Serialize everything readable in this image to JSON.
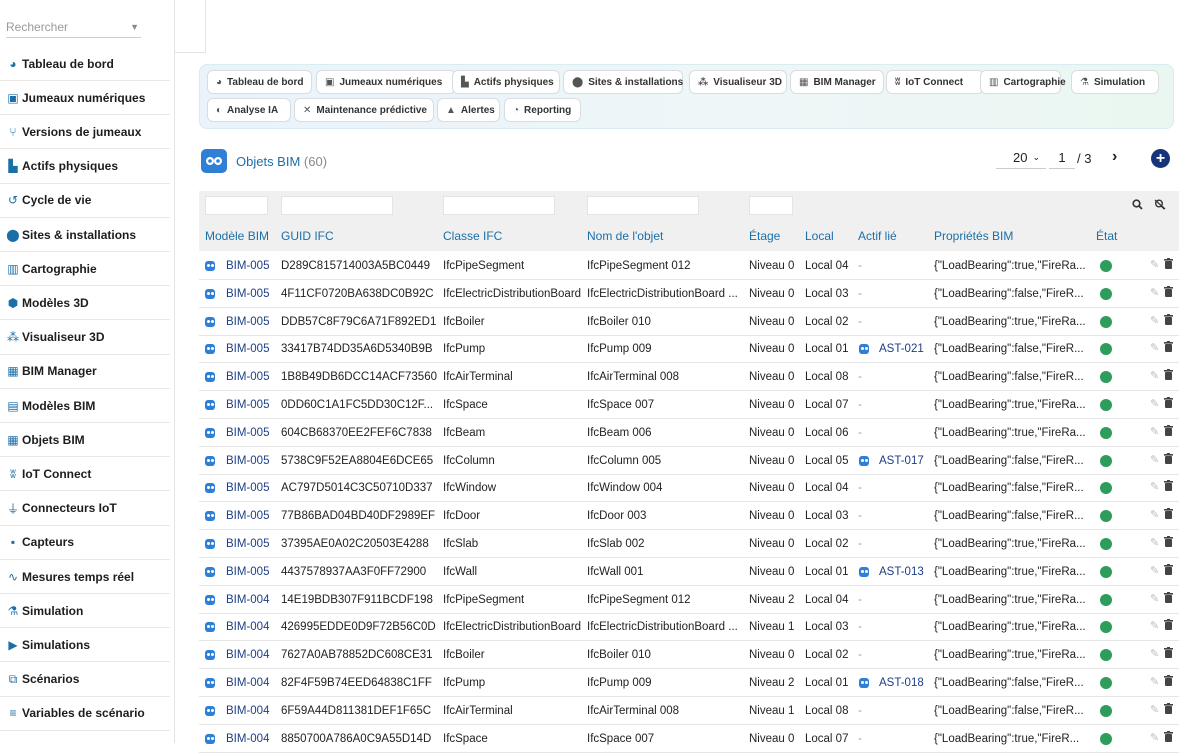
{
  "sidebar": {
    "search_placeholder": "Rechercher",
    "items": [
      {
        "label": "Tableau de bord",
        "icon": "dashboard-icon",
        "glyph": "◕"
      },
      {
        "label": "Jumeaux numériques",
        "icon": "copy-icon",
        "glyph": "▣"
      },
      {
        "label": "Versions de jumeaux",
        "icon": "branch-icon",
        "glyph": "⑂"
      },
      {
        "label": "Actifs physiques",
        "icon": "chart-bar-icon",
        "glyph": "▙"
      },
      {
        "label": "Cycle de vie",
        "icon": "history-icon",
        "glyph": "↺"
      },
      {
        "label": "Sites & installations",
        "icon": "map-marker-icon",
        "glyph": "⬤"
      },
      {
        "label": "Cartographie",
        "icon": "map-icon",
        "glyph": "▥"
      },
      {
        "label": "Modèles 3D",
        "icon": "cube-icon",
        "glyph": "⬢"
      },
      {
        "label": "Visualiseur 3D",
        "icon": "cubes-icon",
        "glyph": "⁂"
      },
      {
        "label": "BIM Manager",
        "icon": "building-icon",
        "glyph": "▦"
      },
      {
        "label": "Modèles BIM",
        "icon": "city-icon",
        "glyph": "▤"
      },
      {
        "label": "Objets BIM",
        "icon": "th-large-icon",
        "glyph": "▦"
      },
      {
        "label": "IoT Connect",
        "icon": "broadcast-icon",
        "glyph": "ʬ"
      },
      {
        "label": "Connecteurs IoT",
        "icon": "plug-icon",
        "glyph": "⏚"
      },
      {
        "label": "Capteurs",
        "icon": "microchip-icon",
        "glyph": "▪"
      },
      {
        "label": "Mesures temps réel",
        "icon": "line-chart-icon",
        "glyph": "∿"
      },
      {
        "label": "Simulation",
        "icon": "flask-icon",
        "glyph": "⚗"
      },
      {
        "label": "Simulations",
        "icon": "play-circle-icon",
        "glyph": "▶"
      },
      {
        "label": "Scénarios",
        "icon": "project-diagram-icon",
        "glyph": "⧉"
      },
      {
        "label": "Variables de scénario",
        "icon": "list-icon",
        "glyph": "≡"
      }
    ]
  },
  "quick_tabs": [
    {
      "label": "Tableau de bord",
      "icon": "dashboard-icon",
      "glyph": "◕"
    },
    {
      "label": "Jumeaux numériques",
      "icon": "copy-icon",
      "glyph": "▣"
    },
    {
      "label": "Actifs physiques",
      "icon": "chart-bar-icon",
      "glyph": "▙"
    },
    {
      "label": "Sites & installations",
      "icon": "map-marker-icon",
      "glyph": "⬤"
    },
    {
      "label": "Visualiseur 3D",
      "icon": "cubes-icon",
      "glyph": "⁂"
    },
    {
      "label": "BIM Manager",
      "icon": "building-icon",
      "glyph": "▦"
    },
    {
      "label": "IoT Connect",
      "icon": "broadcast-icon",
      "glyph": "ʬ"
    },
    {
      "label": "Cartographie",
      "icon": "map-icon",
      "glyph": "▥"
    },
    {
      "label": "Simulation",
      "icon": "flask-icon",
      "glyph": "⚗"
    },
    {
      "label": "Analyse IA",
      "icon": "brain-icon",
      "glyph": "◐"
    },
    {
      "label": "Maintenance prédictive",
      "icon": "tools-icon",
      "glyph": "✕"
    },
    {
      "label": "Alertes",
      "icon": "bell-icon",
      "glyph": "▲"
    },
    {
      "label": "Reporting",
      "icon": "pie-chart-icon",
      "glyph": "◔"
    }
  ],
  "header": {
    "title": "Objets BIM",
    "count": "(60)",
    "page_size": "20",
    "current_page": "1",
    "total_pages": "/ 3"
  },
  "columns": [
    "Modèle BIM",
    "GUID IFC",
    "Classe IFC",
    "Nom de l'objet",
    "Étage",
    "Local",
    "Actif lié",
    "Propriétés BIM",
    "État"
  ],
  "rows": [
    {
      "model": "BIM-005",
      "guid": "D289C815714003A5BC0449",
      "cls": "IfcPipeSegment",
      "name": "IfcPipeSegment 012",
      "floor": "Niveau 0",
      "local": "Local 04",
      "asset": "-",
      "props": "{\"LoadBearing\":true,\"FireRa..."
    },
    {
      "model": "BIM-005",
      "guid": "4F11CF0720BA638DC0B92C",
      "cls": "IfcElectricDistributionBoard",
      "name": "IfcElectricDistributionBoard ...",
      "floor": "Niveau 0",
      "local": "Local 03",
      "asset": "-",
      "props": "{\"LoadBearing\":false,\"FireR..."
    },
    {
      "model": "BIM-005",
      "guid": "DDB57C8F79C6A71F892ED1",
      "cls": "IfcBoiler",
      "name": "IfcBoiler 010",
      "floor": "Niveau 0",
      "local": "Local 02",
      "asset": "-",
      "props": "{\"LoadBearing\":true,\"FireRa..."
    },
    {
      "model": "BIM-005",
      "guid": "33417B74DD35A6D5340B9B",
      "cls": "IfcPump",
      "name": "IfcPump 009",
      "floor": "Niveau 0",
      "local": "Local 01",
      "asset": "AST-021",
      "props": "{\"LoadBearing\":false,\"FireR..."
    },
    {
      "model": "BIM-005",
      "guid": "1B8B49DB6DCC14ACF73560",
      "cls": "IfcAirTerminal",
      "name": "IfcAirTerminal 008",
      "floor": "Niveau 0",
      "local": "Local 08",
      "asset": "-",
      "props": "{\"LoadBearing\":false,\"FireR..."
    },
    {
      "model": "BIM-005",
      "guid": "0DD60C1A1FC5DD30C12F...",
      "cls": "IfcSpace",
      "name": "IfcSpace 007",
      "floor": "Niveau 0",
      "local": "Local 07",
      "asset": "-",
      "props": "{\"LoadBearing\":true,\"FireRa..."
    },
    {
      "model": "BIM-005",
      "guid": "604CB68370EE2FEF6C7838",
      "cls": "IfcBeam",
      "name": "IfcBeam 006",
      "floor": "Niveau 0",
      "local": "Local 06",
      "asset": "-",
      "props": "{\"LoadBearing\":true,\"FireRa..."
    },
    {
      "model": "BIM-005",
      "guid": "5738C9F52EA8804E6DCE65",
      "cls": "IfcColumn",
      "name": "IfcColumn 005",
      "floor": "Niveau 0",
      "local": "Local 05",
      "asset": "AST-017",
      "props": "{\"LoadBearing\":false,\"FireR..."
    },
    {
      "model": "BIM-005",
      "guid": "AC797D5014C3C50710D337",
      "cls": "IfcWindow",
      "name": "IfcWindow 004",
      "floor": "Niveau 0",
      "local": "Local 04",
      "asset": "-",
      "props": "{\"LoadBearing\":false,\"FireR..."
    },
    {
      "model": "BIM-005",
      "guid": "77B86BAD04BD40DF2989EF",
      "cls": "IfcDoor",
      "name": "IfcDoor 003",
      "floor": "Niveau 0",
      "local": "Local 03",
      "asset": "-",
      "props": "{\"LoadBearing\":false,\"FireR..."
    },
    {
      "model": "BIM-005",
      "guid": "37395AE0A02C20503E4288",
      "cls": "IfcSlab",
      "name": "IfcSlab 002",
      "floor": "Niveau 0",
      "local": "Local 02",
      "asset": "-",
      "props": "{\"LoadBearing\":true,\"FireRa..."
    },
    {
      "model": "BIM-005",
      "guid": "4437578937AA3F0FF72900",
      "cls": "IfcWall",
      "name": "IfcWall 001",
      "floor": "Niveau 0",
      "local": "Local 01",
      "asset": "AST-013",
      "props": "{\"LoadBearing\":true,\"FireRa..."
    },
    {
      "model": "BIM-004",
      "guid": "14E19BDB307F911BCDF198",
      "cls": "IfcPipeSegment",
      "name": "IfcPipeSegment 012",
      "floor": "Niveau 2",
      "local": "Local 04",
      "asset": "-",
      "props": "{\"LoadBearing\":true,\"FireRa..."
    },
    {
      "model": "BIM-004",
      "guid": "426995EDDE0D9F72B56C0D",
      "cls": "IfcElectricDistributionBoard",
      "name": "IfcElectricDistributionBoard ...",
      "floor": "Niveau 1",
      "local": "Local 03",
      "asset": "-",
      "props": "{\"LoadBearing\":true,\"FireRa..."
    },
    {
      "model": "BIM-004",
      "guid": "7627A0AB78852DC608CE31",
      "cls": "IfcBoiler",
      "name": "IfcBoiler 010",
      "floor": "Niveau 0",
      "local": "Local 02",
      "asset": "-",
      "props": "{\"LoadBearing\":true,\"FireRa..."
    },
    {
      "model": "BIM-004",
      "guid": "82F4F59B74EED64838C1FF",
      "cls": "IfcPump",
      "name": "IfcPump 009",
      "floor": "Niveau 2",
      "local": "Local 01",
      "asset": "AST-018",
      "props": "{\"LoadBearing\":false,\"FireR..."
    },
    {
      "model": "BIM-004",
      "guid": "6F59A44D811381DEF1F65C",
      "cls": "IfcAirTerminal",
      "name": "IfcAirTerminal 008",
      "floor": "Niveau 1",
      "local": "Local 08",
      "asset": "-",
      "props": "{\"LoadBearing\":false,\"FireR..."
    },
    {
      "model": "BIM-004",
      "guid": "8850700A786A0C9A55D14D",
      "cls": "IfcSpace",
      "name": "IfcSpace 007",
      "floor": "Niveau 0",
      "local": "Local 07",
      "asset": "-",
      "props": "{\"LoadBearing\":true,\"FireR..."
    }
  ],
  "colors": {
    "accent": "#1b6fa8",
    "link": "#1d3f86",
    "status_ok": "#2e9c5b",
    "add_button": "#17337a"
  }
}
